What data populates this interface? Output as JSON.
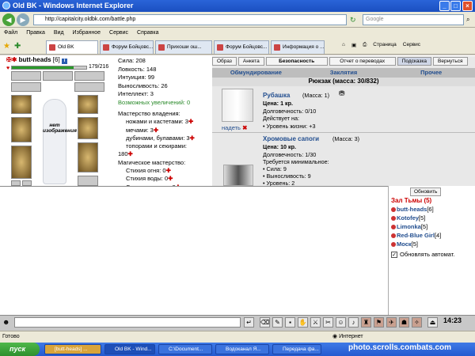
{
  "window": {
    "title": "Old BK - Windows Internet Explorer"
  },
  "address": {
    "url": "http://capitalcity.oldbk.com/battle.php",
    "search_placeholder": "Google"
  },
  "menu": [
    "Файл",
    "Правка",
    "Вид",
    "Избранное",
    "Сервис",
    "Справка"
  ],
  "tabs": [
    {
      "label": "Old BK"
    },
    {
      "label": "Форум Бойцовс..."
    },
    {
      "label": "Прихоши ош..."
    },
    {
      "label": "Форум Бойцовс..."
    },
    {
      "label": "Информация о ..."
    }
  ],
  "tabtools": {
    "page": "Страница",
    "service": "Сервис"
  },
  "character": {
    "name": "butt-heads",
    "level": "[6]",
    "hp_text": "179/216",
    "hp_fraction": 0.83,
    "no_image": "нет изображения"
  },
  "stats": {
    "strength": "Сила: 208",
    "agility": "Ловкость: 148",
    "intuition": "Интуиция: 99",
    "endurance": "Выносливость: 26",
    "intellect": "Интеллект: 3",
    "possible": "Возможных увеличений: 0"
  },
  "skills": {
    "title": "Мастерство владения:",
    "knives": "ножами и кастетами: 3",
    "swords": "мечами: 3",
    "clubs": "дубинами, булавами: 3",
    "axes": "топорами и секирами:",
    "axes_value": "180",
    "magic_title": "Магическое мастерство:",
    "fire": "Стихия огня: 0",
    "water": "Стихия воды: 0",
    "air": "Стихия воздуха: 0"
  },
  "topbuttons": [
    "Образ",
    "Анкета",
    "Безопасность",
    "Отчет о переводах",
    "Подсказка",
    "Вернуться"
  ],
  "invtabs": [
    "Обмундирование",
    "Заклятия",
    "Прочее"
  ],
  "backpack": "Рюкзак (масса: 30/832)",
  "items": [
    {
      "name": "Рубашка",
      "mass": "(Масса: 1)",
      "price": "Цена: 1 кр.",
      "durability": "Долговечность: 0/10",
      "effect_title": "Действует на:",
      "effect": "• Уровень жизни: +3",
      "puton": "надеть"
    },
    {
      "name": "Хромовые сапоги",
      "mass": "(Масса: 3)",
      "price": "Цена: 10 кр.",
      "durability": "Долговечность: 1/30",
      "req_title": "Требуется минимальное:",
      "req1": "• Сила: 9",
      "req2": "• Выносливость: 9",
      "req3": "• Уровень: 2"
    }
  ],
  "chat": {
    "refresh": "Обновить",
    "hall": "Зал Тьмы (5)",
    "users": [
      {
        "name": "butt-heads",
        "level": "[6]"
      },
      {
        "name": "Kotofey",
        "level": "[5]"
      },
      {
        "name": "Limonka",
        "level": "[5]"
      },
      {
        "name": "Red-Blue Girl",
        "level": "[4]"
      },
      {
        "name": "Моск",
        "level": "[5]"
      }
    ],
    "autoupdate": "Обновлять автомат.",
    "clock": "14:23"
  },
  "statusbar": {
    "left": "Готово",
    "zone": "Интернет"
  },
  "taskbar": {
    "start": "пуск",
    "tasks": [
      "[butt-heads] ...",
      "Old BK - Wind...",
      "C:\\Document...",
      "Водоканал Я...",
      "Передача фа..."
    ],
    "watermark": "photo.scrolls.combats.com"
  }
}
